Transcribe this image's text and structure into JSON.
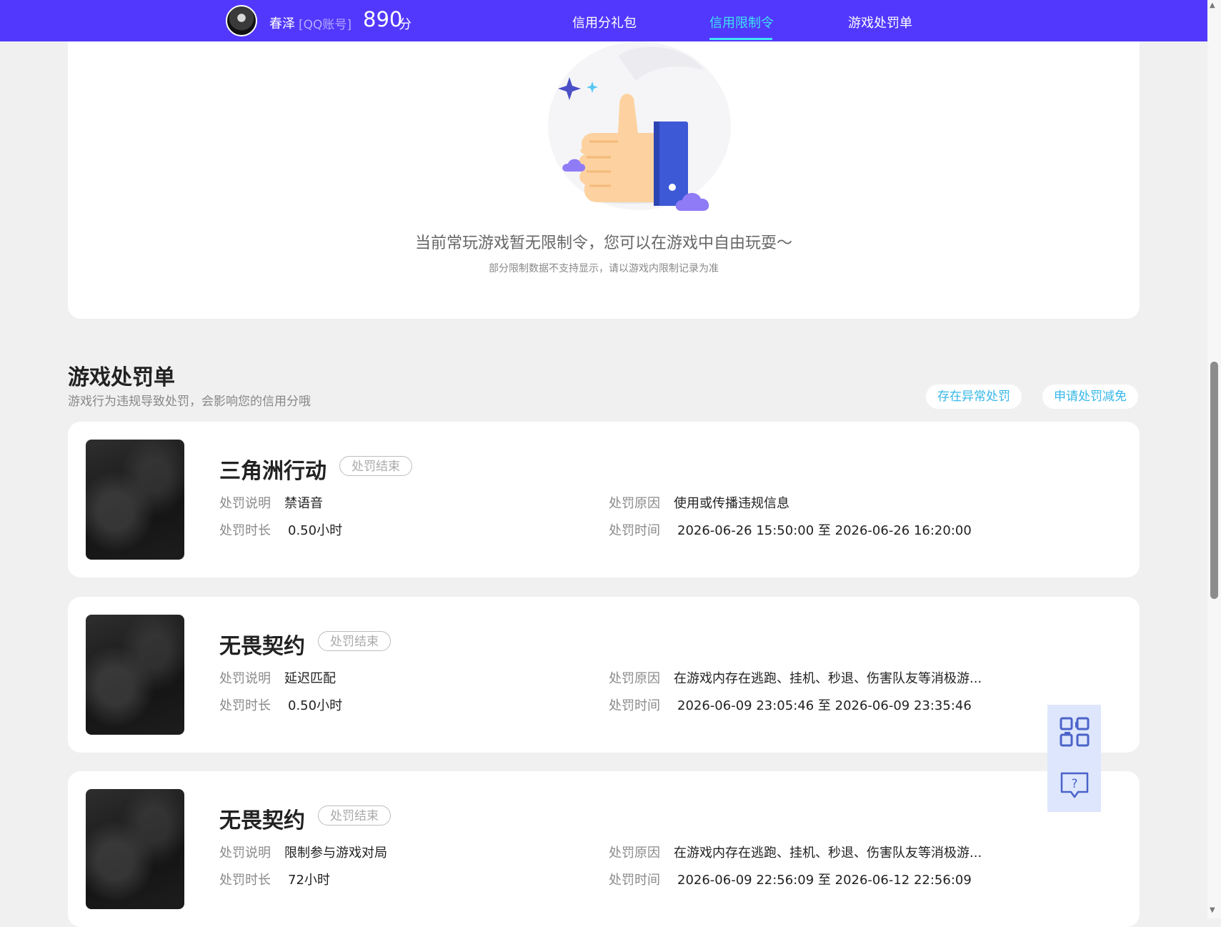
{
  "header": {
    "username": "春泽",
    "account_type": "[QQ账号]",
    "score": "890",
    "score_unit": "分",
    "nav": [
      {
        "label": "信用分礼包"
      },
      {
        "label": "信用限制令"
      },
      {
        "label": "游戏处罚单"
      }
    ]
  },
  "restriction": {
    "empty_title": "当前常玩游戏暂无限制令，您可以在游戏中自由玩耍～",
    "empty_subtitle": "部分限制数据不支持显示，请以游戏内限制记录为准"
  },
  "penalties": {
    "title": "游戏处罚单",
    "subtitle": "游戏行为违规导致处罚，会影响您的信用分哦",
    "btn_abnormal": "存在异常处罚",
    "btn_appeal": "申请处罚减免",
    "labels": {
      "desc": "处罚说明",
      "duration": "处罚时长",
      "reason": "处罚原因",
      "time": "处罚时间"
    },
    "items": [
      {
        "game": "三角洲行动",
        "status": "处罚结束",
        "desc": "禁语音",
        "duration": "0.50小时",
        "reason": "使用或传播违规信息",
        "time": "2026-06-26 15:50:00 至 2026-06-26 16:20:00"
      },
      {
        "game": "无畏契约",
        "status": "处罚结束",
        "desc": "延迟匹配",
        "duration": "0.50小时",
        "reason": "在游戏内存在逃跑、挂机、秒退、伤害队友等消极游...",
        "time": "2026-06-09 23:05:46 至 2026-06-09 23:35:46"
      },
      {
        "game": "无畏契约",
        "status": "处罚结束",
        "desc": "限制参与游戏对局",
        "duration": "72小时",
        "reason": "在游戏内存在逃跑、挂机、秒退、伤害队友等消极游...",
        "time": "2026-06-09 22:56:09 至 2026-06-12 22:56:09"
      }
    ]
  },
  "floating": {
    "qr_icon": "qr-code-icon",
    "help_icon": "help-chat-icon"
  },
  "colors": {
    "topbar": "#5238fc",
    "active_nav": "#3ee3f5",
    "link": "#37b7e8"
  }
}
